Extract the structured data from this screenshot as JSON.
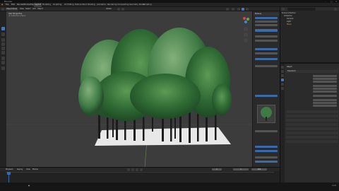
{
  "window": {
    "title": "Blender"
  },
  "menu": {
    "items": [
      "File",
      "Edit",
      "Render",
      "Window",
      "Help"
    ],
    "workspaces": [
      "Layout",
      "Modeling",
      "Sculpting",
      "UV Editing",
      "Texture Paint",
      "Shading",
      "Animation",
      "Rendering",
      "Compositing",
      "Geometry Nodes",
      "Scripting"
    ]
  },
  "viewport_header": {
    "mode": "Object Mode",
    "view": "View",
    "select": "Select",
    "add": "Add",
    "object": "Object",
    "global": "Global"
  },
  "viewport": {
    "perspective": "User Perspective",
    "collection": "(1) Collection | Plane"
  },
  "outliner": {
    "title": "Scene Collection",
    "collection": "Collection",
    "items": [
      "Camera",
      "Light",
      "Plane"
    ]
  },
  "side_panel": {
    "header": "Botaniq"
  },
  "props": {
    "tab": "Object",
    "section": "Transform"
  },
  "timeline": {
    "playback": "Playback",
    "keying": "Keying",
    "view": "View",
    "marker": "Marker",
    "frame": "1",
    "start": "1",
    "end": "250"
  },
  "status": {
    "version": "3.2.0"
  },
  "colors": {
    "select_blue": "#3c6aa6",
    "accent": "#4a74b8"
  }
}
